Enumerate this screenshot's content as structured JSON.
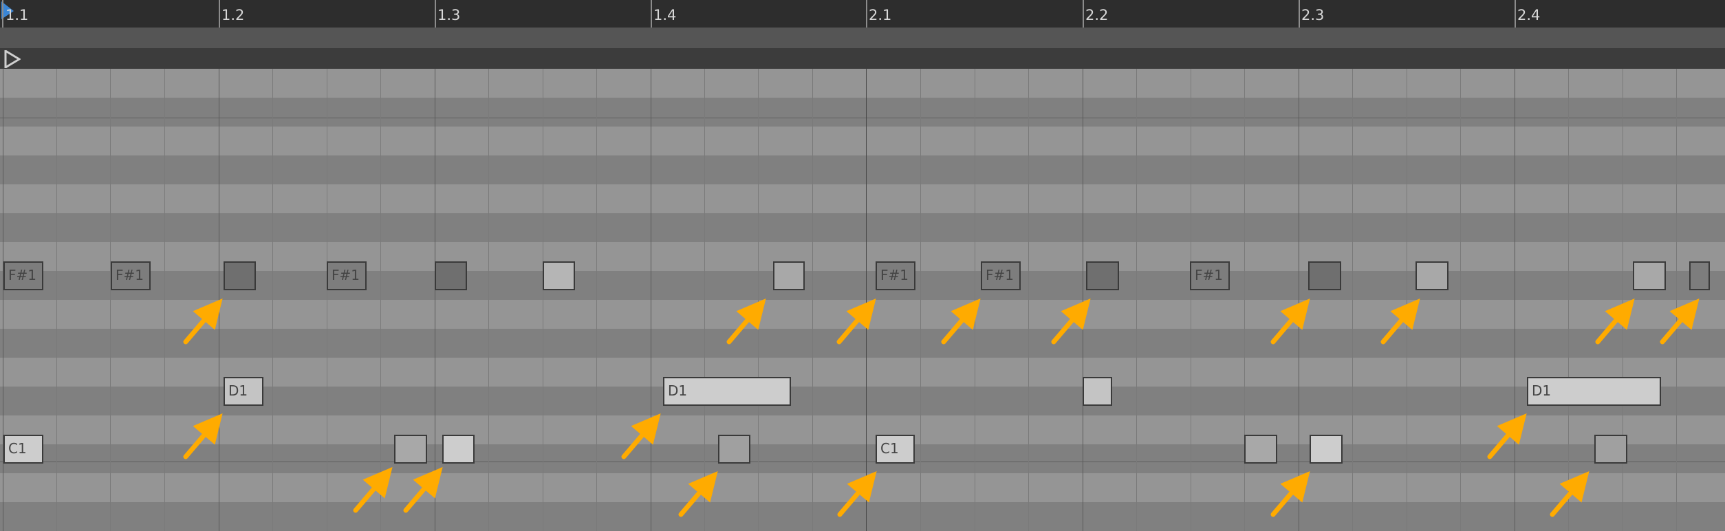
{
  "ruler": {
    "labels": [
      "1.1",
      "1.2",
      "1.3",
      "1.4",
      "2.1",
      "2.2",
      "2.3",
      "2.4"
    ]
  },
  "notes": {
    "f_sharp_1": "F#1",
    "d1": "D1",
    "c1": "C1"
  },
  "colors": {
    "background": "#8a8a8a",
    "lane_dark": "#808080",
    "lane_light": "#959595",
    "ruler": "#2d2d2d",
    "playhead": "#3a86d6",
    "note_dark": "#7d7d7d",
    "note_mid": "#a8a8a8",
    "note_light": "#cdcdcd",
    "arrow": "#ffab00"
  },
  "icons": {
    "playhead": "playhead-marker-icon",
    "loop_start": "loop-start-marker-icon"
  }
}
